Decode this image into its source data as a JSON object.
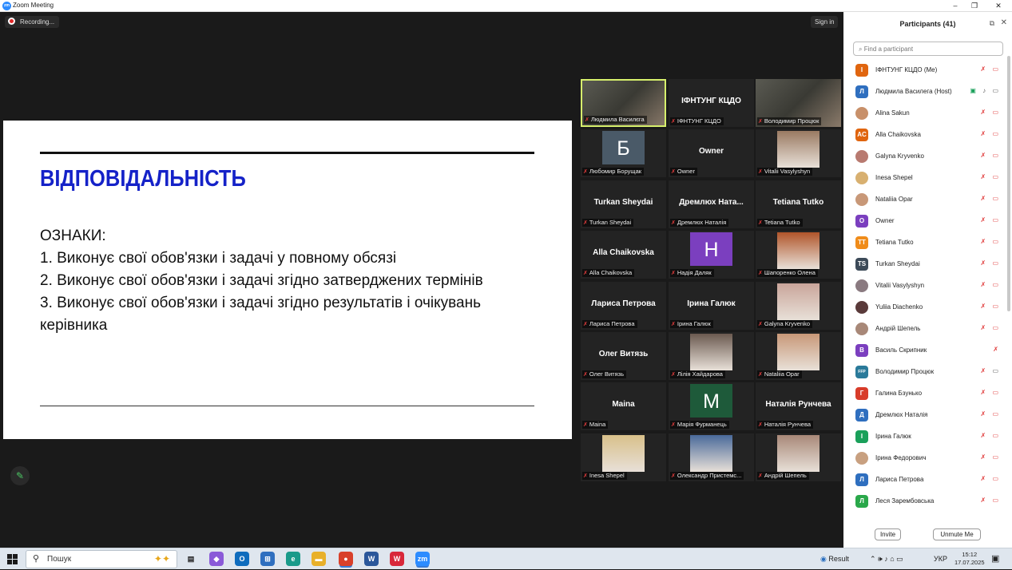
{
  "window": {
    "title": "Zoom Meeting",
    "min": "–",
    "max": "❐",
    "close": "✕"
  },
  "meeting": {
    "recording_label": "Recording...",
    "sign_in": "Sign in"
  },
  "slide": {
    "title": "ВІДПОВІДАЛЬНІСТЬ",
    "heading": "ОЗНАКИ:",
    "items": [
      "1. Виконує свої обов'язки і задачі у повному обсязі",
      "2. Виконує свої обов'язки і задачі згідно затверджених термінів",
      "3. Виконує свої обов'язки і задачі згідно результатів і очікувань керівника"
    ]
  },
  "gallery": [
    {
      "label": "Людмила Василєга",
      "kind": "camera",
      "active": true
    },
    {
      "label": "ІФНТУНГ КЦДО",
      "kind": "name",
      "big": "ІФНТУНГ КЦДО"
    },
    {
      "label": "Володимир Процюк",
      "kind": "camera"
    },
    {
      "label": "Любомир Борущак",
      "kind": "avatar",
      "letter": "Б",
      "color": "#4a5a68"
    },
    {
      "label": "Owner",
      "kind": "name",
      "big": "Owner"
    },
    {
      "label": "Vitalii Vasylyshyn",
      "kind": "photo",
      "color": "#9a7a62"
    },
    {
      "label": "Turkan Sheydai",
      "kind": "name",
      "big": "Turkan Sheydai"
    },
    {
      "label": "Дремлюх Наталія",
      "kind": "name",
      "big": "Дремлюх Ната..."
    },
    {
      "label": "Tetiana Tutko",
      "kind": "name",
      "big": "Tetiana Tutko"
    },
    {
      "label": "Alla Chaikovska",
      "kind": "name",
      "big": "Alla Chaikovska"
    },
    {
      "label": "Надія Даляк",
      "kind": "avatar",
      "letter": "Н",
      "color": "#7b3fbf"
    },
    {
      "label": "Шапоренко Олена",
      "kind": "photo",
      "color": "#b0552a"
    },
    {
      "label": "Лариса Петрова",
      "kind": "name",
      "big": "Лариса Петрова"
    },
    {
      "label": "Ірина Галюк",
      "kind": "name",
      "big": "Ірина Галюк"
    },
    {
      "label": "Galyna Kryvenko",
      "kind": "photo",
      "color": "#c9a59a"
    },
    {
      "label": "Олег Витязь",
      "kind": "name",
      "big": "Олег Витязь"
    },
    {
      "label": "Лілія Хайдарова",
      "kind": "photo",
      "color": "#6b5a50"
    },
    {
      "label": "Nataliia Opar",
      "kind": "photo",
      "color": "#c89878"
    },
    {
      "label": "Maina",
      "kind": "name",
      "big": "Maina"
    },
    {
      "label": "Марія Фурманець",
      "kind": "avatar",
      "letter": "M",
      "color": "#1e5a3a"
    },
    {
      "label": "Наталія Рунчева",
      "kind": "name",
      "big": "Наталія Рунчева"
    },
    {
      "label": "Inesa Shepel",
      "kind": "photo",
      "color": "#d8c08a"
    },
    {
      "label": "Олександр Пристемс...",
      "kind": "photo",
      "color": "#4a6a9a"
    },
    {
      "label": "Андрій Шепель",
      "kind": "photo",
      "color": "#a88878"
    }
  ],
  "participants": {
    "title": "Participants (41)",
    "search_placeholder": "Find a participant",
    "invite": "Invite",
    "unmute_me": "Unmute Me",
    "list": [
      {
        "name": "ІФНТУНГ КЦДО (Me)",
        "initials": "І",
        "color": "#e0650f"
      },
      {
        "name": "Людмила Василега (Host)",
        "initials": "Л",
        "color": "#2f6fbf"
      },
      {
        "name": "Alina Sakun",
        "initials": "",
        "color": "#c8906a"
      },
      {
        "name": "Alla Chaikovska",
        "initials": "AC",
        "color": "#e0650f"
      },
      {
        "name": "Galyna Kryvenko",
        "initials": "",
        "color": "#b87a70"
      },
      {
        "name": "Inesa Shepel",
        "initials": "",
        "color": "#d8b070"
      },
      {
        "name": "Nataliia Opar",
        "initials": "",
        "color": "#c89878"
      },
      {
        "name": "Owner",
        "initials": "O",
        "color": "#7b3fbf"
      },
      {
        "name": "Tetiana Tutko",
        "initials": "TT",
        "color": "#f08c1a"
      },
      {
        "name": "Turkan Sheydai",
        "initials": "TS",
        "color": "#3c4a58"
      },
      {
        "name": "Vitalii Vasylyshyn",
        "initials": "",
        "color": "#8a7a80"
      },
      {
        "name": "Yuliia Diachenko",
        "initials": "",
        "color": "#5a3a3a"
      },
      {
        "name": "Андрій Шепель",
        "initials": "",
        "color": "#a88878"
      },
      {
        "name": "Василь Скрипник",
        "initials": "В",
        "color": "#7b3fbf"
      },
      {
        "name": "Володимир Процюк",
        "initials": "FFP",
        "color": "#2a7a9a"
      },
      {
        "name": "Галина Бзунько",
        "initials": "Г",
        "color": "#d83c2a"
      },
      {
        "name": "Дремлюх Наталія",
        "initials": "Д",
        "color": "#2f6fbf"
      },
      {
        "name": "Ірина Галюк",
        "initials": "І",
        "color": "#1aa05a"
      },
      {
        "name": "Ірина Федорович",
        "initials": "",
        "color": "#c8a080"
      },
      {
        "name": "Лариса Петрова",
        "initials": "Л",
        "color": "#2f6fbf"
      },
      {
        "name": "Леся Зарембовська",
        "initials": "Л",
        "color": "#2aa84a"
      }
    ]
  },
  "taskbar": {
    "search": "Пошук",
    "weather": "Result",
    "lang": "УКР",
    "time": "15:12",
    "date": "17.07.2025"
  }
}
